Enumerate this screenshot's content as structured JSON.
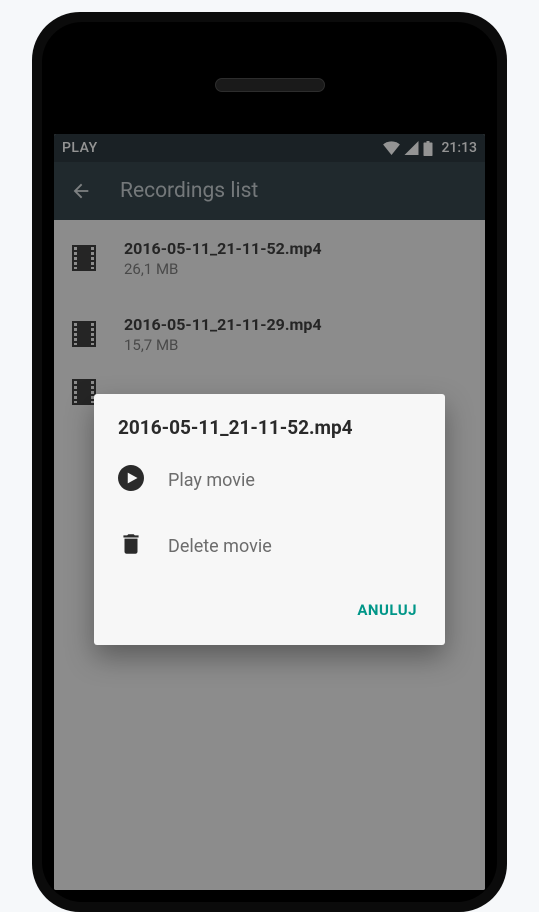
{
  "status_bar": {
    "carrier": "PLAY",
    "time": "21:13"
  },
  "app_bar": {
    "title": "Recordings list"
  },
  "recordings": [
    {
      "filename": "2016-05-11_21-11-52.mp4",
      "size": "26,1 MB"
    },
    {
      "filename": "2016-05-11_21-11-29.mp4",
      "size": "15,7 MB"
    }
  ],
  "dialog": {
    "title": "2016-05-11_21-11-52.mp4",
    "play_label": "Play movie",
    "delete_label": "Delete movie",
    "cancel_label": "ANULUJ"
  }
}
